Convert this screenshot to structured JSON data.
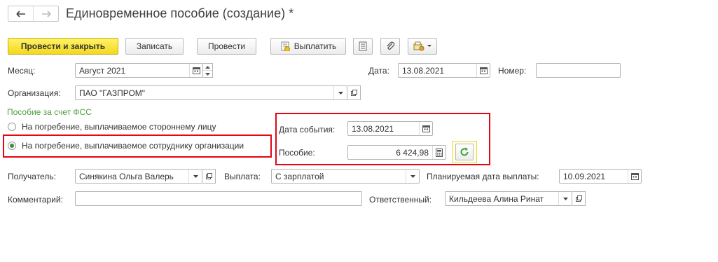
{
  "window": {
    "title": "Единовременное пособие (создание) *"
  },
  "toolbar": {
    "post_and_close": "Провести и закрыть",
    "save": "Записать",
    "post": "Провести",
    "pay": "Выплатить"
  },
  "form": {
    "month": {
      "label": "Месяц:",
      "value": "Август 2021"
    },
    "date": {
      "label": "Дата:",
      "value": "13.08.2021"
    },
    "number": {
      "label": "Номер:",
      "value": ""
    },
    "organization": {
      "label": "Организация:",
      "value": "ПАО \"ГАЗПРОМ\""
    },
    "benefit_section": {
      "title": "Пособие за счет ФСС",
      "options": [
        {
          "label": "На погребение, выплачиваемое стороннему лицу",
          "selected": false
        },
        {
          "label": "На погребение, выплачиваемое сотруднику организации",
          "selected": true
        }
      ]
    },
    "event_date": {
      "label": "Дата события:",
      "value": "13.08.2021"
    },
    "benefit": {
      "label": "Пособие:",
      "value": "6 424,98"
    },
    "recipient": {
      "label": "Получатель:",
      "value": "Синякина Ольга Валерь"
    },
    "payment": {
      "label": "Выплата:",
      "value": "С зарплатой"
    },
    "planned_date": {
      "label": "Планируемая дата выплаты:",
      "value": "10.09.2021"
    },
    "comment": {
      "label": "Комментарий:",
      "value": ""
    },
    "responsible": {
      "label": "Ответственный:",
      "value": "Кильдеева Алина Ринат"
    }
  },
  "colors": {
    "primary_button": "#f2d81d",
    "highlight_border": "#e30613",
    "section_title": "#4f9e3f",
    "refresh_icon": "#3fa535"
  },
  "icons": [
    "back-arrow-icon",
    "forward-arrow-icon",
    "pay-icon",
    "report-icon",
    "attachment-icon",
    "print-icon",
    "calendar-icon",
    "dropdown-icon",
    "open-icon",
    "refresh-icon",
    "calculator-icon"
  ]
}
